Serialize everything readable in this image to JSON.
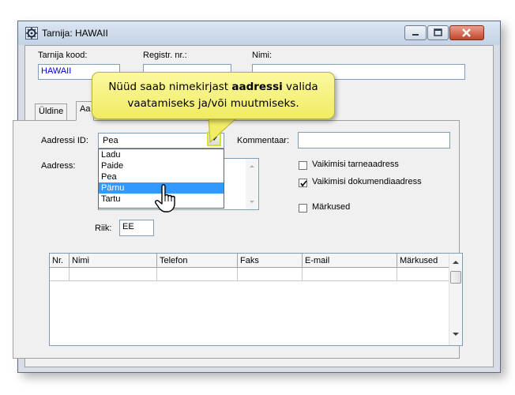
{
  "window": {
    "title": "Tarnija: HAWAII"
  },
  "header": {
    "supplier_code_label": "Tarnija kood:",
    "supplier_code_value": "HAWAII",
    "reg_no_label": "Registr. nr.:",
    "name_label": "Nimi:"
  },
  "tabs": [
    {
      "label": "Üldine"
    },
    {
      "label": "Aa"
    }
  ],
  "address": {
    "id_label": "Aadressi ID:",
    "id_value": "Pea",
    "options": [
      "Ladu",
      "Paide",
      "Pea",
      "Pärnu",
      "Tartu"
    ],
    "selected_index": 3,
    "address_label": "Aadress:",
    "comment_label": "Kommentaar:",
    "country_label": "Riik:",
    "country_value": "EE"
  },
  "checkboxes": [
    {
      "label": "Vaikimisi tarneaadress",
      "checked": false
    },
    {
      "label": "Vaikimisi dokumendiaadress",
      "checked": true
    },
    {
      "label": "Märkused",
      "checked": false
    }
  ],
  "table": {
    "columns": [
      "Nr.",
      "Nimi",
      "Telefon",
      "Faks",
      "E-mail",
      "Märkused"
    ]
  },
  "callout": {
    "text_before": "Nüüd saab nimekirjast ",
    "text_bold": "aadressi",
    "text_after": " valida vaatamiseks ja/või muutmiseks."
  },
  "colors": {
    "selection": "#3399ff",
    "callout": "#f5f07a",
    "highlight": "#d7e32a"
  },
  "icons": [
    "app-gear-icon",
    "minimize-icon",
    "maximize-icon",
    "close-icon",
    "chevron-down-icon",
    "hand-pointer-icon"
  ]
}
